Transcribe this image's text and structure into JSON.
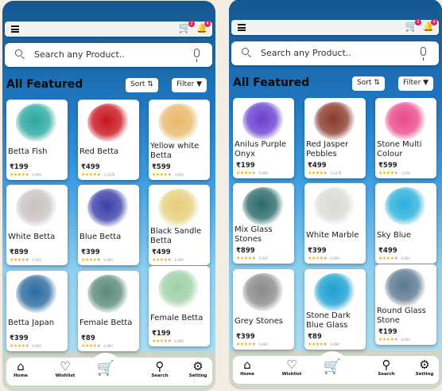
{
  "phones": [
    {
      "cart_count": "2",
      "notif_count": "4",
      "search_placeholder": "Search any Product..",
      "section_title": "All Featured",
      "sort_label": "Sort",
      "filter_label": "Filter",
      "products": [
        {
          "name": "Betta Fish",
          "price": "₹199",
          "reviews": "6,890",
          "color": "#2aa8a0"
        },
        {
          "name": "Red Betta",
          "price": "₹499",
          "reviews": "13,678",
          "color": "#c8141c"
        },
        {
          "name": "Yellow white Betta",
          "price": "₹599",
          "reviews": "3,004",
          "color": "#e8b86a"
        },
        {
          "name": "White Betta",
          "price": "₹899",
          "reviews": "5,045",
          "color": "#c9c2c0"
        },
        {
          "name": "Blue Betta",
          "price": "₹399",
          "reviews": "6,890",
          "color": "#3a3fa8"
        },
        {
          "name": "Black Sandle Betta",
          "price": "₹499",
          "reviews": "6,890",
          "color": "#e6cf7a"
        },
        {
          "name": "Betta Japan",
          "price": "₹399",
          "reviews": "6,890",
          "color": "#2a6aa0"
        },
        {
          "name": "Female Betta",
          "price": "₹89",
          "reviews": "6,890",
          "color": "#5a8a78"
        },
        {
          "name": "Female Betta",
          "price": "₹199",
          "reviews": "6,890",
          "color": "#9fd0a8"
        }
      ]
    },
    {
      "cart_count": "2",
      "notif_count": "4",
      "search_placeholder": "Search any Product..",
      "section_title": "All Featured",
      "sort_label": "Sort",
      "filter_label": "Filter",
      "products": [
        {
          "name": "Anilus Purple Onyx",
          "price": "₹199",
          "reviews": "6,890",
          "color": "#6a3fd0"
        },
        {
          "name": "Red Jasper Pebbles",
          "price": "₹499",
          "reviews": "13,678",
          "color": "#8a3a2a"
        },
        {
          "name": "Stone Multi Colour",
          "price": "₹599",
          "reviews": "3,004",
          "color": "#e84a8a"
        },
        {
          "name": "Mix Glass Stones",
          "price": "₹899",
          "reviews": "5,045",
          "color": "#2a6a6a"
        },
        {
          "name": "White Marble",
          "price": "₹399",
          "reviews": "6,890",
          "color": "#dcdad6"
        },
        {
          "name": "Sky Blue",
          "price": "₹499",
          "reviews": "6,890",
          "color": "#2ab0dc"
        },
        {
          "name": "Grey Stones",
          "price": "₹399",
          "reviews": "6,890",
          "color": "#8a8a8a"
        },
        {
          "name": "Stone Dark Blue Glass",
          "price": "₹89",
          "reviews": "6,890",
          "color": "#1aa0d0"
        },
        {
          "name": "Round Glass Stone",
          "price": "₹199",
          "reviews": "6,890",
          "color": "#5a7890"
        }
      ]
    }
  ],
  "nav": {
    "home": "Home",
    "wishlist": "Wishlist",
    "search": "Search",
    "setting": "Setting"
  },
  "rating_stars": 4
}
